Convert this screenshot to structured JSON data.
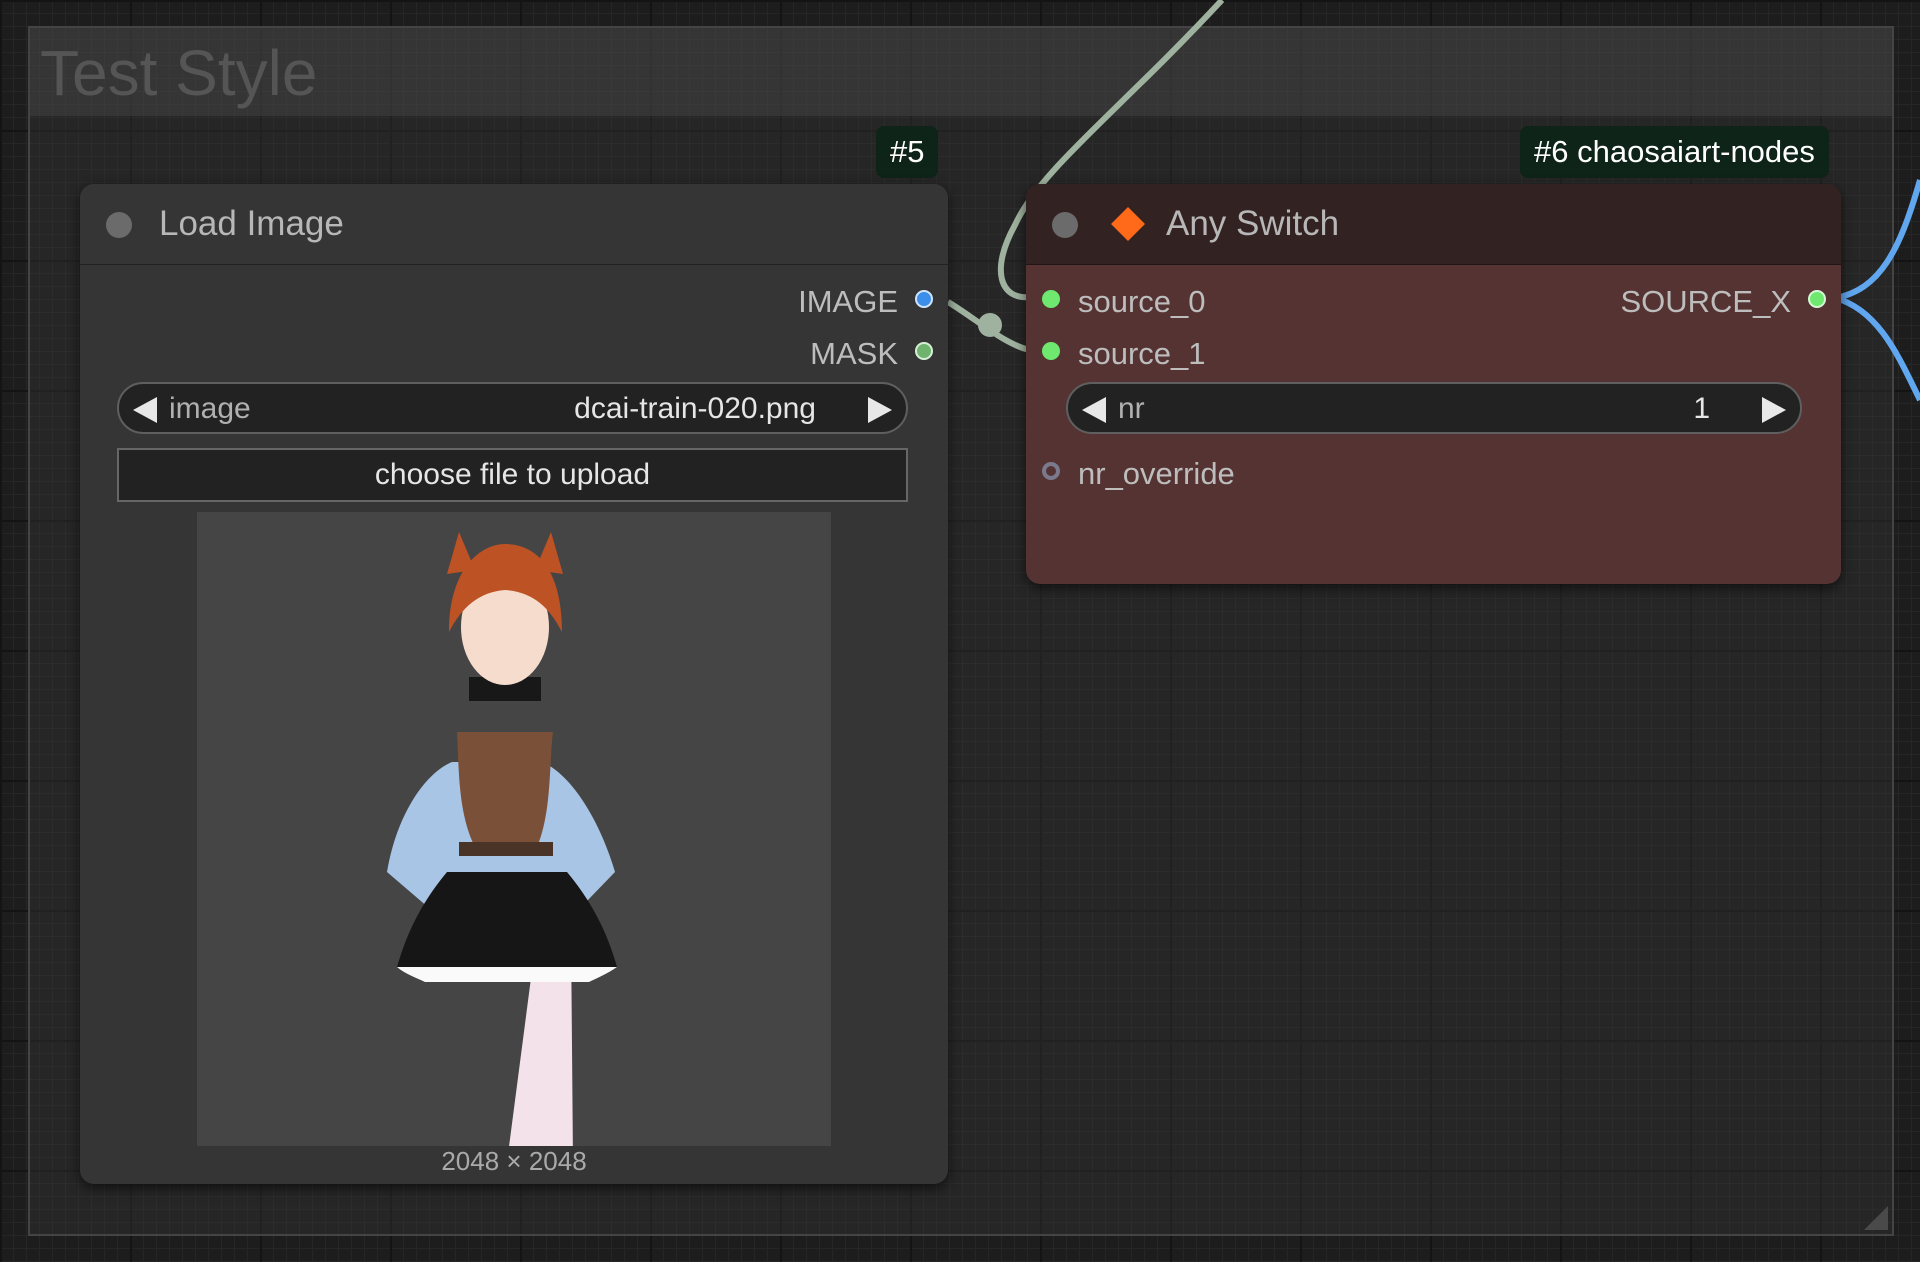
{
  "group": {
    "title": "Test Style"
  },
  "load_image_node": {
    "badge": "#5",
    "title": "Load Image",
    "outputs": [
      {
        "label": "IMAGE",
        "color": "#3b8fea"
      },
      {
        "label": "MASK",
        "color": "#6fb36f"
      }
    ],
    "image_widget": {
      "label": "image",
      "value": "dcai-train-020.png"
    },
    "upload_label": "choose file to upload",
    "preview_dims": "2048 × 2048"
  },
  "any_switch_node": {
    "badge": "#6 chaosaiart-nodes",
    "title": "Any Switch",
    "icon_color": "#ff6a1a",
    "inputs": [
      {
        "label": "source_0"
      },
      {
        "label": "source_1"
      }
    ],
    "output": {
      "label": "SOURCE_X"
    },
    "nr_widget": {
      "label": "nr",
      "value": "1"
    },
    "optional_input": {
      "label": "nr_override"
    }
  },
  "colors": {
    "canvas": "#1d1d1d",
    "node_body": "#353535",
    "switch_body": "#553333",
    "switch_title": "#332222",
    "wire_gray": "#9fb29f",
    "wire_blue": "#60a7f0",
    "slot_green": "#6ee86e"
  }
}
